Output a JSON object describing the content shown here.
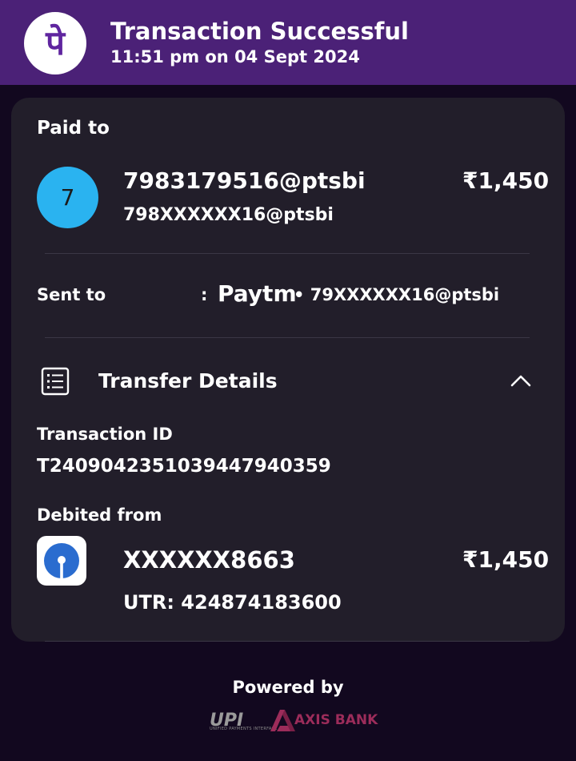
{
  "header": {
    "logo_glyph": "पे",
    "title": "Transaction Successful",
    "subtitle": "11:51 pm on 04 Sept 2024"
  },
  "paid_to": {
    "label": "Paid to",
    "avatar_letter": "7",
    "name": "7983179516@ptsbi",
    "upi_id": "798XXXXXX16@ptsbi",
    "amount": "₹1,450"
  },
  "sent_to": {
    "label": "Sent to",
    "colon": ":",
    "app_logo": "Paytm",
    "upi_id": "• 79XXXXXX16@ptsbi"
  },
  "transfer_details": {
    "title": "Transfer Details",
    "transaction_id_label": "Transaction ID",
    "transaction_id": "T2409042351039447940359",
    "debited_from_label": "Debited from",
    "account_number": "XXXXXX8663",
    "account_amount": "₹1,450",
    "utr": "UTR: 424874183600"
  },
  "footer": {
    "powered_by": "Powered by",
    "upi_logo": "UPI",
    "upi_subtext": "UNIFIED PAYMENTS INTERFACE",
    "bank_name": "AXIS BANK"
  },
  "colors": {
    "header_bg": "#4b2177",
    "page_bg": "#12081f",
    "card_bg": "#221e2a",
    "avatar_bg": "#2ab3f0",
    "phonepe_purple": "#5f259f",
    "sbi_blue": "#2a6ccf",
    "axis_maroon": "#9c2c5a"
  },
  "icons": {
    "header": "phonepe-logo-icon",
    "transfer": "receipt-list-icon",
    "collapse": "chevron-up-icon",
    "bank": "sbi-logo-icon",
    "axis": "axis-bank-logo-icon"
  }
}
